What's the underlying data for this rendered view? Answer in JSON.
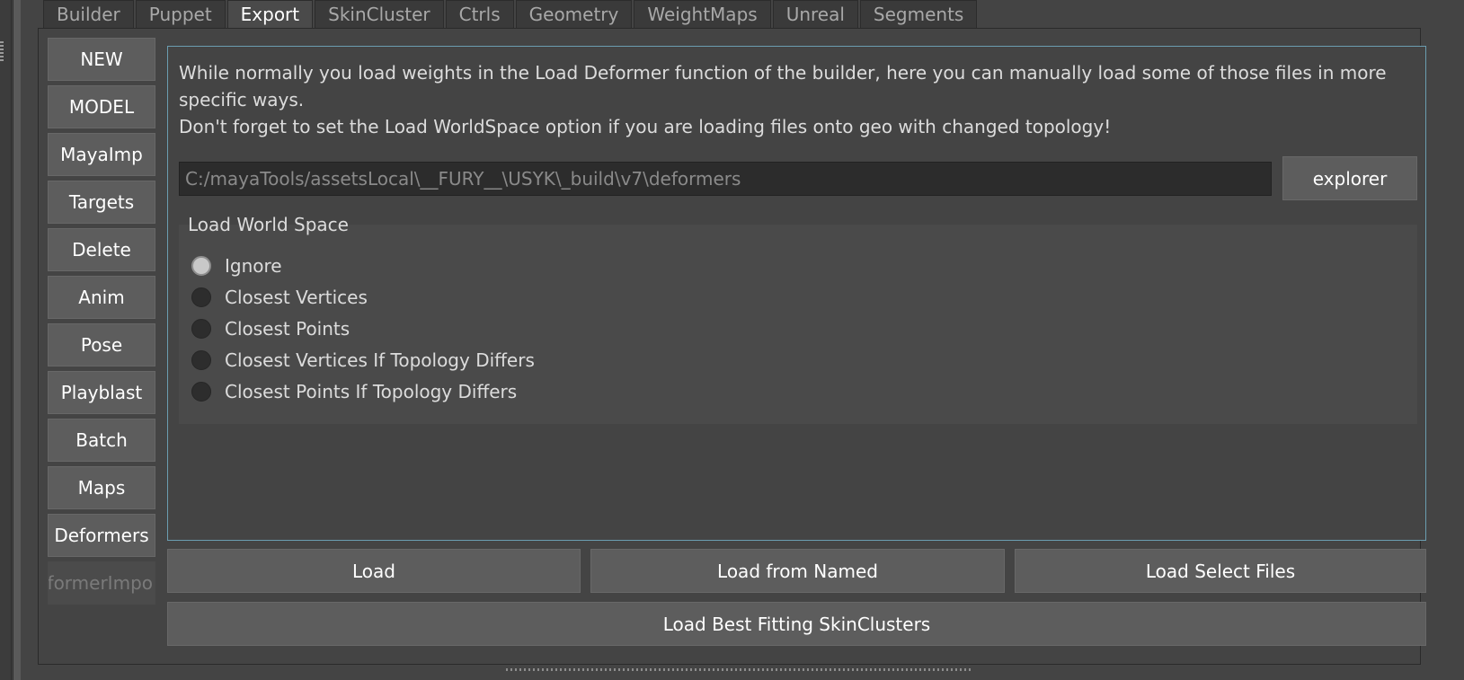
{
  "tabs": [
    {
      "label": "Builder",
      "active": false
    },
    {
      "label": "Puppet",
      "active": false
    },
    {
      "label": "Export",
      "active": true
    },
    {
      "label": "SkinCluster",
      "active": false
    },
    {
      "label": "Ctrls",
      "active": false
    },
    {
      "label": "Geometry",
      "active": false
    },
    {
      "label": "WeightMaps",
      "active": false
    },
    {
      "label": "Unreal",
      "active": false
    },
    {
      "label": "Segments",
      "active": false
    }
  ],
  "sidebar": {
    "items": [
      {
        "label": "NEW"
      },
      {
        "label": "MODEL"
      },
      {
        "label": "MayaImp"
      },
      {
        "label": "Targets"
      },
      {
        "label": "Delete"
      },
      {
        "label": "Anim"
      },
      {
        "label": "Pose"
      },
      {
        "label": "Playblast"
      },
      {
        "label": "Batch"
      },
      {
        "label": "Maps"
      },
      {
        "label": "Deformers"
      },
      {
        "label": "eformerImpo"
      }
    ]
  },
  "main": {
    "description_line1": "While normally you load weights in the Load Deformer function of the builder, here you can manually load some of those      files in more specific ways.",
    "description_line2": "Don't forget to set the Load WorldSpace option if you are loading files onto geo with changed topology!",
    "path_value": "C:/mayaTools/assetsLocal\\__FURY__\\USYK\\_build\\v7\\deformers",
    "explorer_label": "explorer",
    "world_space": {
      "title": "Load World Space",
      "options": [
        {
          "label": "Ignore",
          "selected": true
        },
        {
          "label": "Closest Vertices",
          "selected": false
        },
        {
          "label": "Closest Points",
          "selected": false
        },
        {
          "label": "Closest Vertices If Topology Differs",
          "selected": false
        },
        {
          "label": "Closest Points If Topology Differs",
          "selected": false
        }
      ]
    }
  },
  "buttons": {
    "load": "Load",
    "load_from_named": "Load from Named",
    "load_select_files": "Load Select Files",
    "load_best_fitting": "Load Best Fitting SkinClusters"
  },
  "colors": {
    "background": "#444444",
    "button": "#5d5d5d",
    "focus_border": "#6b9db0"
  }
}
